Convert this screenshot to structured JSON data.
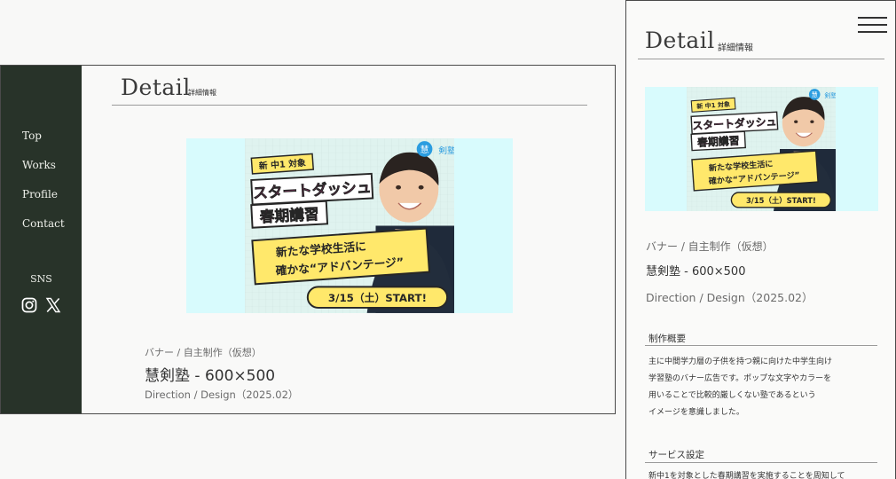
{
  "desktop": {
    "nav": [
      "Top",
      "Works",
      "Profile",
      "Contact"
    ],
    "sns_label": "SNS",
    "sns_icons": [
      "instagram-icon",
      "x-icon"
    ],
    "title": "Detail",
    "subtitle": "詳細情報",
    "banner": {
      "badge_left": "新 中1 対象",
      "headline_1": "スタートダッシュ",
      "headline_2": "春期講習",
      "sub_1": "新たな学校生活に",
      "sub_2": "確かな“アドバンテージ”",
      "start": "3/15（土）START!",
      "logo": "慧剣塾"
    },
    "category": "バナー / 自主制作（仮想）",
    "name": "慧剣塾 - 600×500",
    "meta": "Direction / Design（2025.02）"
  },
  "mobile": {
    "title": "Detail",
    "subtitle": "詳細情報",
    "category": "バナー / 自主制作（仮想）",
    "name": "慧剣塾 - 600×500",
    "meta": "Direction / Design（2025.02）",
    "section1_heading": "制作概要",
    "section1_lines": [
      "主に中間学力層の子供を持つ親に向けた中学生向け",
      "学習塾のバナー広告です。ポップな文字やカラーを",
      "用いることで比較的厳しくない塾であるという",
      "イメージを意識しました。"
    ],
    "section2_heading": "サービス設定",
    "section2_line": "新中1を対象とした春期講習を実施することを周知して"
  },
  "colors": {
    "sidebar": "#283329",
    "banner_bg": "#d8fbfd",
    "banner_pink": "#ff3ea6",
    "banner_yellow": "#ffe86b",
    "banner_dark": "#262626"
  }
}
